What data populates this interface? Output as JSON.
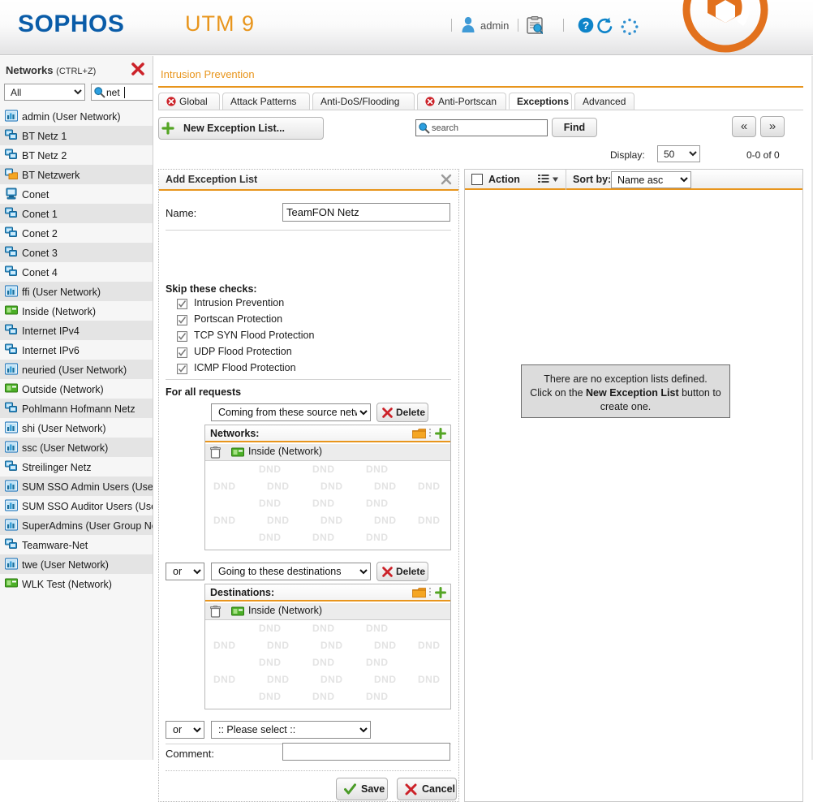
{
  "header": {
    "brand": "SOPHOS",
    "product": "UTM 9",
    "user_label": "admin",
    "icons": [
      "user-icon",
      "clipboard-search-icon",
      "help-icon",
      "reload-icon",
      "spinner-icon",
      "sophos-shield-logo"
    ]
  },
  "sidebar": {
    "title": "Networks",
    "title_shortcut": "(CTRL+Z)",
    "close_icon": "close-icon",
    "filter_selected": "All",
    "filter_options": [
      "All"
    ],
    "search_value": "net",
    "search_icon": "magnifier-icon",
    "items": [
      {
        "label": "admin (User Network)",
        "icon": "user-network-icon"
      },
      {
        "label": "BT Netz 1",
        "icon": "network-group-icon"
      },
      {
        "label": "BT Netz 2",
        "icon": "network-group-icon"
      },
      {
        "label": "BT Netzwerk",
        "icon": "network-folder-icon"
      },
      {
        "label": "Conet",
        "icon": "host-icon"
      },
      {
        "label": "Conet 1",
        "icon": "network-group-icon"
      },
      {
        "label": "Conet 2",
        "icon": "network-group-icon"
      },
      {
        "label": "Conet 3",
        "icon": "network-group-icon"
      },
      {
        "label": "Conet 4",
        "icon": "network-group-icon"
      },
      {
        "label": "ffi (User Network)",
        "icon": "user-network-icon"
      },
      {
        "label": "Inside (Network)",
        "icon": "interface-network-icon"
      },
      {
        "label": "Internet IPv4",
        "icon": "network-group-icon"
      },
      {
        "label": "Internet IPv6",
        "icon": "network-group-icon"
      },
      {
        "label": "neuried (User Network)",
        "icon": "user-network-icon"
      },
      {
        "label": "Outside (Network)",
        "icon": "interface-network-icon"
      },
      {
        "label": "Pohlmann Hofmann Netz",
        "icon": "network-group-icon"
      },
      {
        "label": "shi (User Network)",
        "icon": "user-network-icon"
      },
      {
        "label": "ssc (User Network)",
        "icon": "user-network-icon"
      },
      {
        "label": "Streilinger Netz",
        "icon": "network-group-icon"
      },
      {
        "label": "SUM SSO Admin Users (User",
        "icon": "user-network-icon"
      },
      {
        "label": "SUM SSO Auditor Users (Use",
        "icon": "user-network-icon"
      },
      {
        "label": "SuperAdmins (User Group Ne",
        "icon": "user-network-icon"
      },
      {
        "label": "Teamware-Net",
        "icon": "network-group-icon"
      },
      {
        "label": "twe (User Network)",
        "icon": "user-network-icon"
      },
      {
        "label": "WLK Test (Network)",
        "icon": "interface-network-icon"
      }
    ]
  },
  "main": {
    "breadcrumb": "Intrusion Prevention",
    "tabs": [
      {
        "label": "Global",
        "badge": "error-badge-icon",
        "active": false
      },
      {
        "label": "Attack Patterns",
        "badge": null,
        "active": false
      },
      {
        "label": "Anti-DoS/Flooding",
        "badge": null,
        "active": false
      },
      {
        "label": "Anti-Portscan",
        "badge": "error-badge-icon",
        "active": false
      },
      {
        "label": "Exceptions",
        "badge": null,
        "active": true
      },
      {
        "label": "Advanced",
        "badge": null,
        "active": false
      }
    ],
    "toolbar": {
      "new_button": "New Exception List...",
      "search_placeholder": "search",
      "find_button": "Find",
      "prev_label": "«",
      "next_label": "»",
      "display_label": "Display:",
      "display_value": "50",
      "display_options": [
        "50"
      ],
      "count_text": "0-0 of 0"
    }
  },
  "form": {
    "title": "Add Exception List",
    "name_label": "Name:",
    "name_value": "TeamFON Netz",
    "skip_title": "Skip these checks:",
    "checks": [
      {
        "label": "Intrusion Prevention",
        "checked": true
      },
      {
        "label": "Portscan Protection",
        "checked": true
      },
      {
        "label": "TCP SYN Flood Protection",
        "checked": true
      },
      {
        "label": "UDP Flood Protection",
        "checked": true
      },
      {
        "label": "ICMP Flood Protection",
        "checked": true
      }
    ],
    "for_all_requests": "For all requests",
    "rule1": {
      "condition": "Coming from these source netw",
      "delete_label": "Delete",
      "box_title": "Networks:",
      "entries": [
        {
          "label": "Inside (Network)",
          "icon": "interface-network-icon"
        }
      ],
      "dnd_hint": "DND"
    },
    "rule2": {
      "joiner": "or",
      "joiner_options": [
        "or"
      ],
      "condition": "Going to these destinations",
      "delete_label": "Delete",
      "box_title": "Destinations:",
      "entries": [
        {
          "label": "Inside (Network)",
          "icon": "interface-network-icon"
        }
      ],
      "dnd_hint": "DND"
    },
    "rule3": {
      "joiner": "or",
      "joiner_options": [
        "or"
      ],
      "condition": ":: Please select ::"
    },
    "comment_label": "Comment:",
    "comment_value": "",
    "save_label": "Save",
    "cancel_label": "Cancel"
  },
  "list_panel": {
    "action_label": "Action",
    "sort_label": "Sort by:",
    "sort_value": "Name asc",
    "sort_options": [
      "Name asc"
    ],
    "empty_line1": "There are no exception lists defined.",
    "empty_line2_pre": "Click on the ",
    "empty_line2_strong": "New Exception List",
    "empty_line2_post": " button to",
    "empty_line3": "create one."
  },
  "colors": {
    "brand_blue": "#0a5ca8",
    "accent_orange": "#e8951c",
    "error_red": "#cc2229",
    "ok_green": "#4a9b27"
  }
}
